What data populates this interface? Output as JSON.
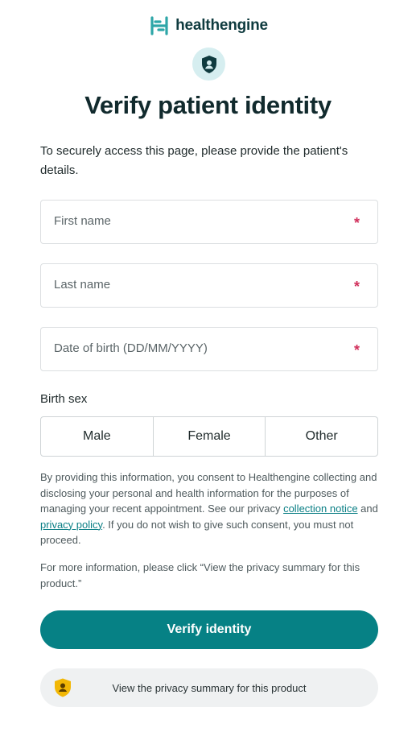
{
  "brand": {
    "name": "healthengine"
  },
  "page": {
    "title": "Verify patient identity"
  },
  "intro": "To securely access this page, please provide the patient's details.",
  "fields": [
    {
      "placeholder": "First name",
      "required_mark": "*"
    },
    {
      "placeholder": "Last name",
      "required_mark": "*"
    },
    {
      "placeholder": "Date of birth (DD/MM/YYYY)",
      "required_mark": "*"
    }
  ],
  "birth_sex": {
    "label": "Birth sex",
    "options": [
      "Male",
      "Female",
      "Other"
    ]
  },
  "consent": {
    "part1": "By providing this information, you consent to Healthengine collecting and disclosing your personal and health information for the purposes of managing your recent appointment. See our privacy ",
    "link1": "collection notice",
    "and": " and ",
    "link2": "privacy policy",
    "part2": ". If you do not wish to give such consent, you must not proceed."
  },
  "more_info": "For more information, please click “View the privacy summary for this product.”",
  "buttons": {
    "verify": "Verify identity",
    "privacy_summary": "View the privacy summary for this product"
  },
  "colors": {
    "primary": "#068185",
    "brand_dark": "#0f3b3f",
    "required": "#d1305c",
    "badge": "#f2b705"
  },
  "icons": {
    "logo": "healthengine-logo-icon",
    "shield": "shield-person-icon",
    "privacy": "shield-badge-icon"
  }
}
